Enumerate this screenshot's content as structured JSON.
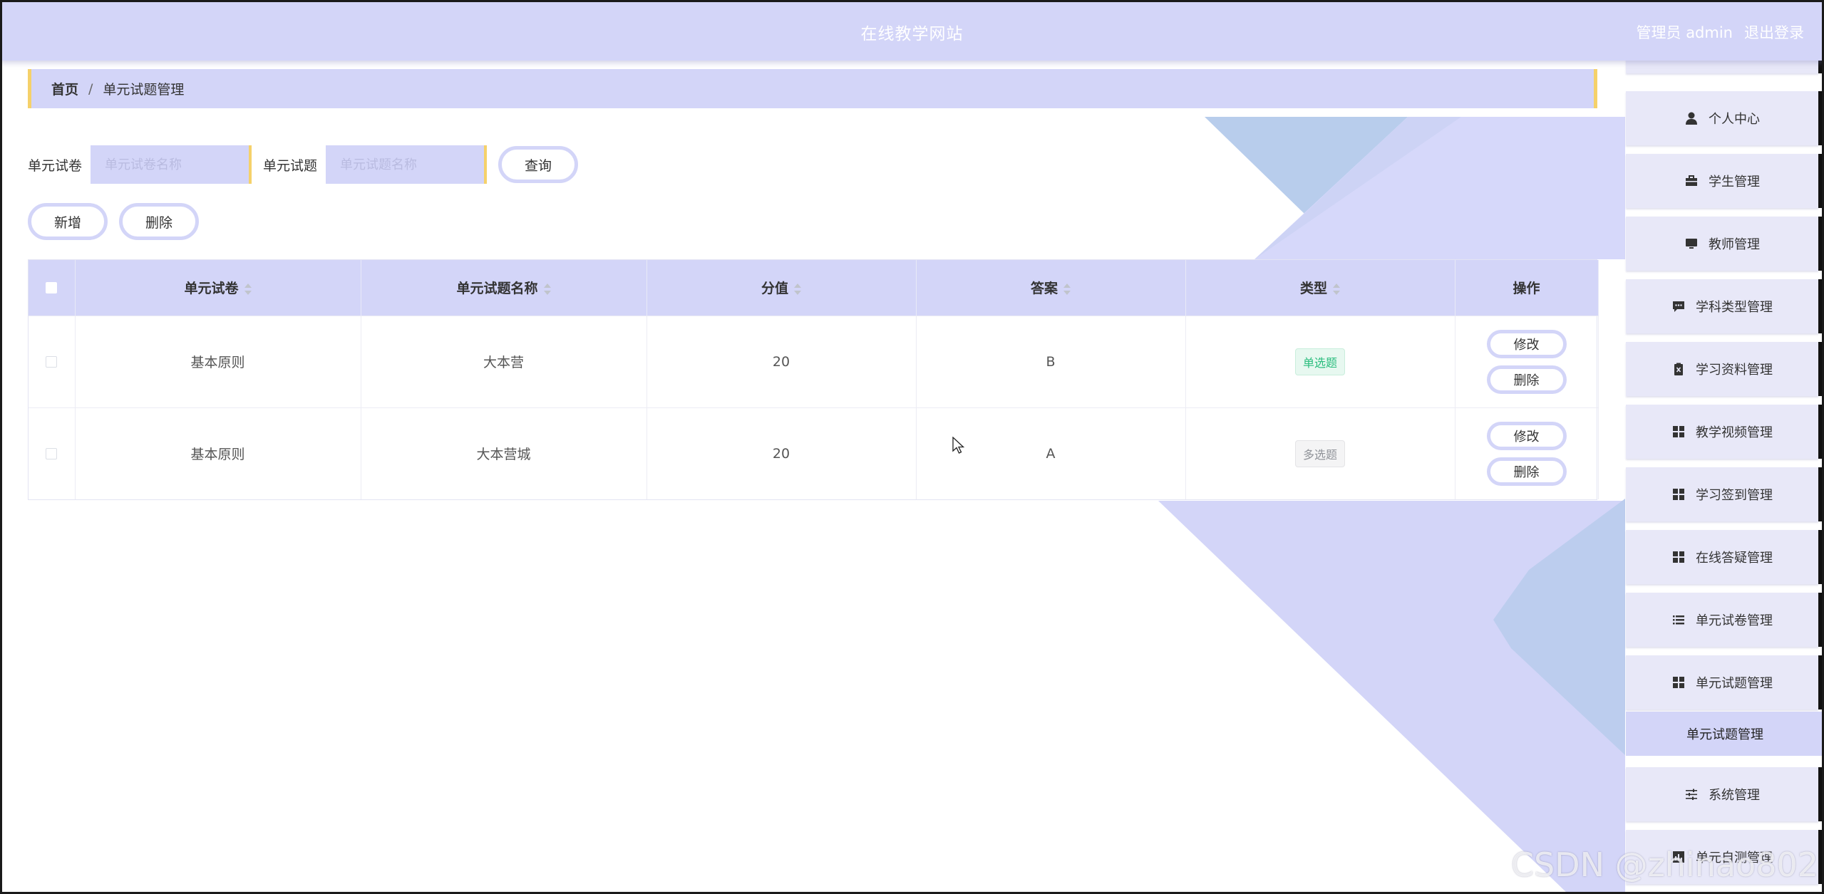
{
  "header": {
    "site_title": "在线教学网站",
    "user_label": "管理员 admin",
    "logout_label": "退出登录"
  },
  "breadcrumb": {
    "home": "首页",
    "separator": "/",
    "current": "单元试题管理"
  },
  "search": {
    "paper_label": "单元试卷",
    "paper_placeholder": "单元试卷名称",
    "question_label": "单元试题",
    "question_placeholder": "单元试题名称",
    "query_button": "查询"
  },
  "actions": {
    "add_button": "新增",
    "delete_button": "删除"
  },
  "table": {
    "columns": [
      "单元试卷",
      "单元试题名称",
      "分值",
      "答案",
      "类型",
      "操作"
    ],
    "rows": [
      {
        "paper": "基本原则",
        "name": "大本营",
        "score": "20",
        "answer": "B",
        "type": "单选题",
        "edit": "修改",
        "delete": "删除"
      },
      {
        "paper": "基本原则",
        "name": "大本营城",
        "score": "20",
        "answer": "A",
        "type": "多选题",
        "edit": "修改",
        "delete": "删除"
      }
    ]
  },
  "sidebar": {
    "items": [
      {
        "label": "个人中心",
        "icon": "user-icon"
      },
      {
        "label": "学生管理",
        "icon": "briefcase-icon"
      },
      {
        "label": "教师管理",
        "icon": "monitor-icon"
      },
      {
        "label": "学科类型管理",
        "icon": "chat-icon"
      },
      {
        "label": "学习资料管理",
        "icon": "clipboard-icon"
      },
      {
        "label": "教学视频管理",
        "icon": "grid-icon"
      },
      {
        "label": "学习签到管理",
        "icon": "grid-icon"
      },
      {
        "label": "在线答疑管理",
        "icon": "grid-icon"
      },
      {
        "label": "单元试卷管理",
        "icon": "list-icon"
      },
      {
        "label": "单元试题管理",
        "icon": "grid-icon"
      },
      {
        "label": "系统管理",
        "icon": "sliders-icon"
      },
      {
        "label": "单元自测管理",
        "icon": "chart-icon"
      }
    ],
    "active_sub": "单元试题管理"
  },
  "watermark": "CSDN @zhinao802",
  "colors": {
    "primary_light": "#d3d5f8",
    "accent_yellow": "#f5d16a",
    "tag_single": "#2bbd7e",
    "deco_blue": "#b8cdec"
  }
}
